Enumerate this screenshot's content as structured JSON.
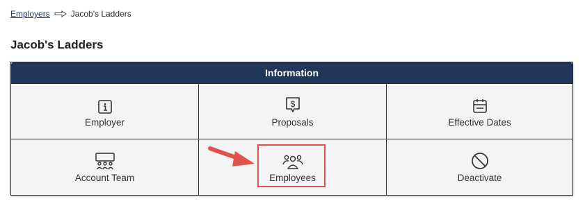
{
  "breadcrumb": {
    "parent_label": "Employers",
    "separator_icon": "arrow-right-icon",
    "current_label": "Jacob's Ladders"
  },
  "page": {
    "title": "Jacob's Ladders"
  },
  "panel": {
    "header": "Information",
    "items": [
      {
        "label": "Employer",
        "icon": "info-icon"
      },
      {
        "label": "Proposals",
        "icon": "dollar-speech-bubble-icon"
      },
      {
        "label": "Effective Dates",
        "icon": "calendar-icon"
      },
      {
        "label": "Account Team",
        "icon": "team-meeting-icon"
      },
      {
        "label": "Employees",
        "icon": "people-icon"
      },
      {
        "label": "Deactivate",
        "icon": "prohibited-icon"
      }
    ]
  },
  "annotation": {
    "highlight_color": "#d9534f",
    "highlighted_item": "Employees"
  },
  "colors": {
    "header_bg": "#213658",
    "cell_bg": "#f3f3f3",
    "link": "#1f3a68"
  }
}
